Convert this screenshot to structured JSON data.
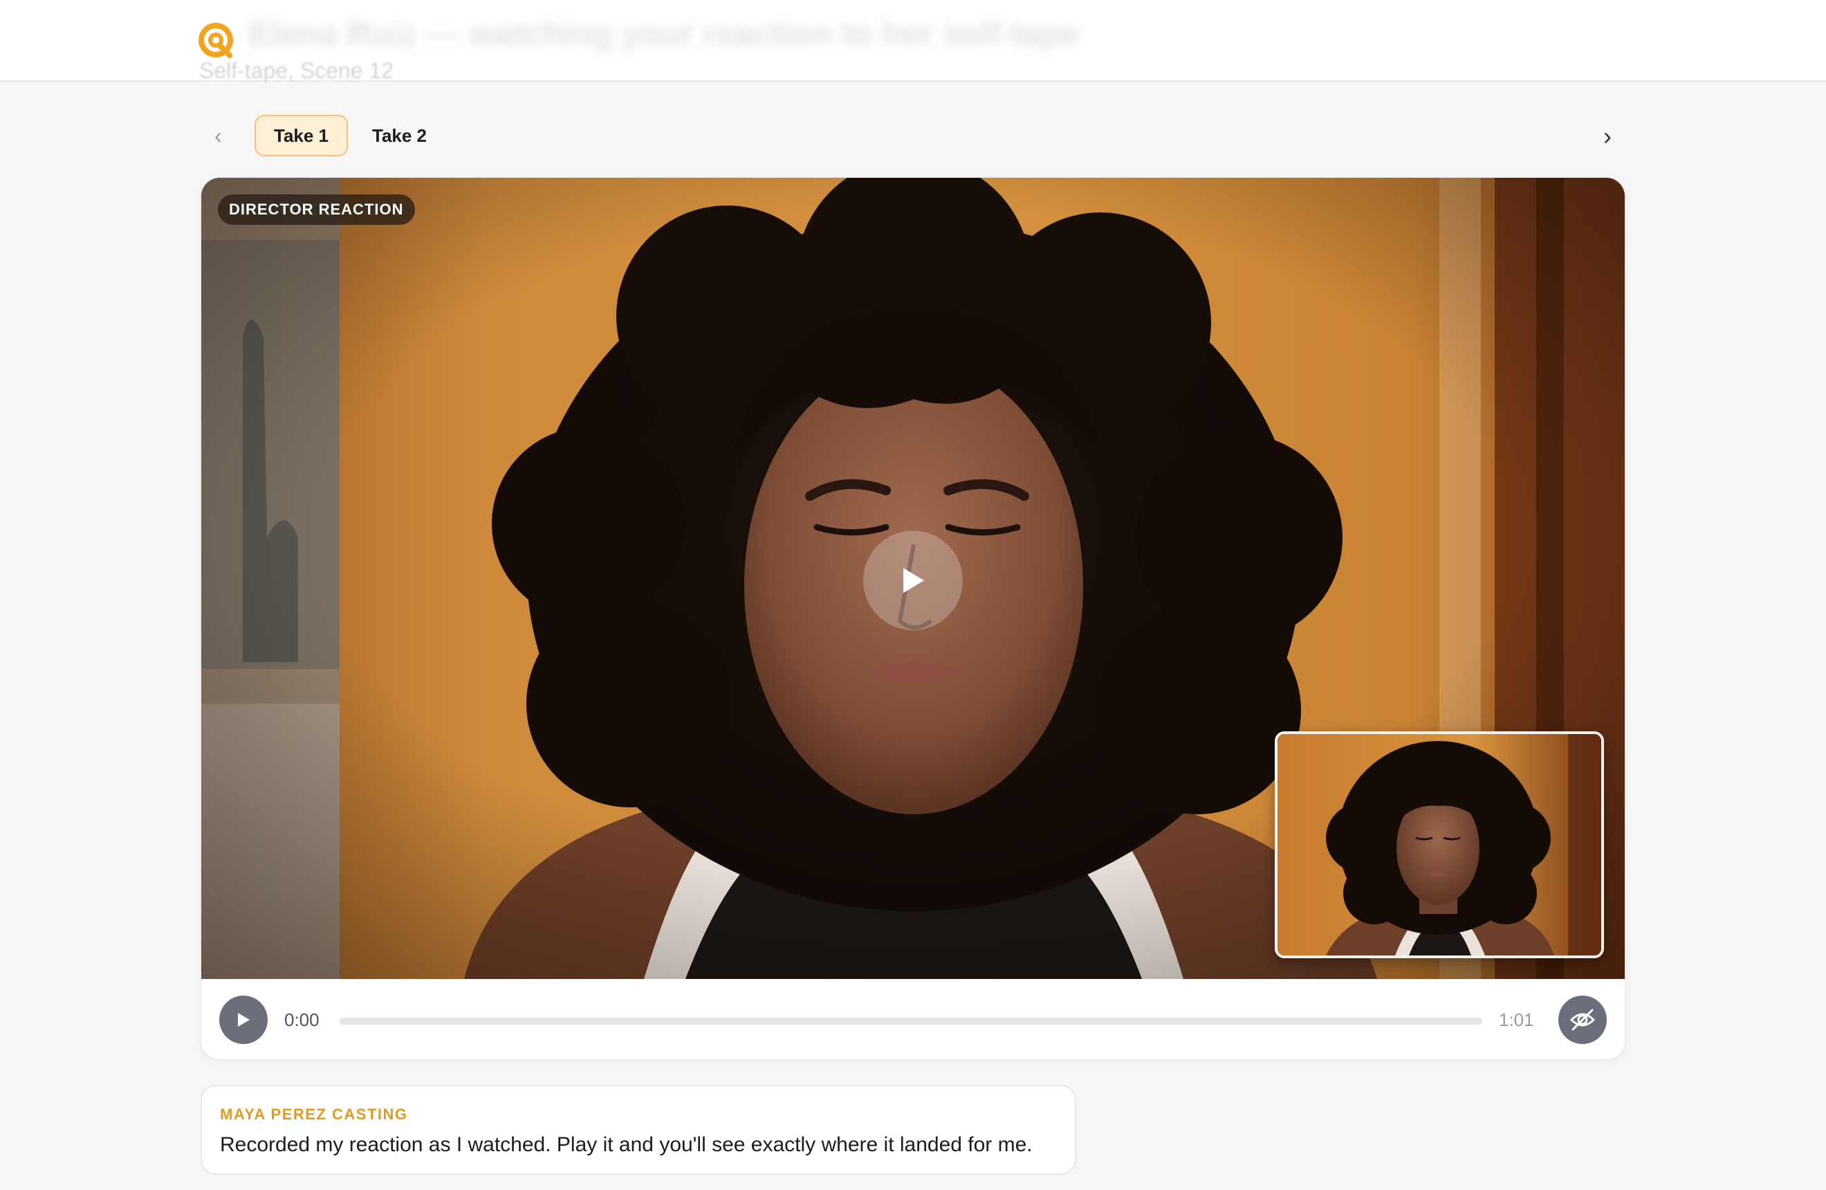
{
  "header": {
    "title": "Elena Ruiz — watching your reaction to her self-tape",
    "subtitle": "Self-tape, Scene 12",
    "logo_icon": "q-logo-icon",
    "accent_color": "#f2a320"
  },
  "tabs": {
    "prev_label": "‹",
    "next_label": "›",
    "items": [
      {
        "label": "Take 1",
        "active": true
      },
      {
        "label": "Take 2",
        "active": false
      }
    ]
  },
  "player": {
    "badge": "DIRECTOR REACTION",
    "time_current": "0:00",
    "time_total": "1:01",
    "progress": 0,
    "play_icon": "play-icon",
    "hide_icon": "eye-off-icon"
  },
  "message": {
    "author": "MAYA PEREZ CASTING",
    "text": "Recorded my reaction as I watched. Play it and you'll see exactly where it landed for me."
  }
}
